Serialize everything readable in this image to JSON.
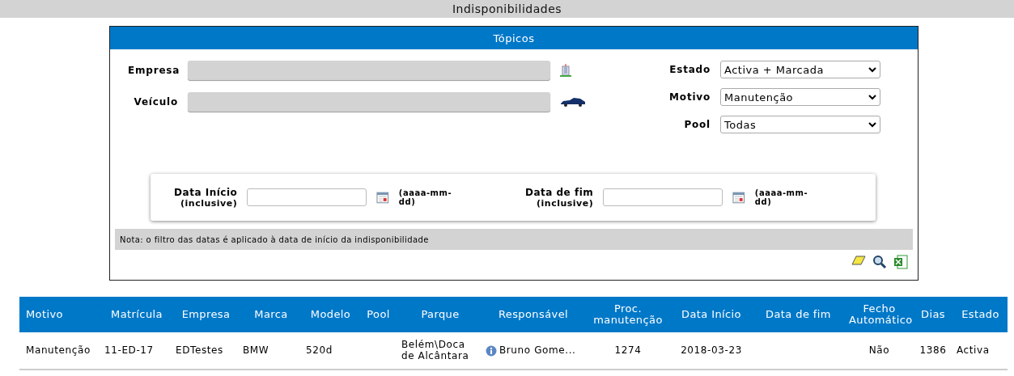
{
  "page_title": "Indisponibilidades",
  "filters": {
    "title": "Tópicos",
    "left_fields": [
      {
        "label": "Empresa",
        "kind": "company"
      },
      {
        "label": "Veículo",
        "kind": "vehicle"
      }
    ],
    "right_fields": [
      {
        "label": "Estado",
        "value": "Activa + Marcada"
      },
      {
        "label": "Motivo",
        "value": "Manutenção"
      },
      {
        "label": "Pool",
        "value": "Todas"
      }
    ],
    "dates": [
      {
        "label": "Data Início",
        "sublabel": "(inclusive)",
        "format": "(aaaa-mm-dd)"
      },
      {
        "label": "Data de fim",
        "sublabel": "(inclusive)",
        "format": "(aaaa-mm-dd)"
      }
    ],
    "note": "Nota: o filtro das datas é aplicado à data de início da indisponibilidade",
    "actions": [
      {
        "kind": "clear"
      },
      {
        "kind": "search"
      },
      {
        "kind": "excel"
      }
    ]
  },
  "table": {
    "columns": [
      "Motivo",
      "Matrícula",
      "Empresa",
      "Marca",
      "Modelo",
      "Pool",
      "Parque",
      "Responsável",
      "Proc. manutenção",
      "Data Início",
      "Data de fim",
      "Fecho Automático",
      "Dias",
      "Estado"
    ],
    "rows": [
      {
        "cells": [
          "Manutenção",
          "11-ED-17",
          "EDTestes",
          "BMW",
          "520d",
          "",
          "Belém\\Doca de Alcântara",
          "Bruno Gome...",
          "1274",
          "2018-03-23",
          "",
          "Não",
          "1386",
          "Activa"
        ]
      }
    ]
  }
}
